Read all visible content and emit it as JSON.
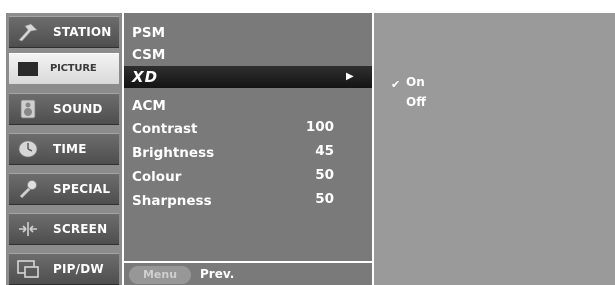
{
  "sidebar": {
    "items": [
      {
        "label": "STATION",
        "icon": "station-icon"
      },
      {
        "label": "PICTURE",
        "icon": "picture-icon",
        "selected": true
      },
      {
        "label": "SOUND",
        "icon": "sound-icon"
      },
      {
        "label": "TIME",
        "icon": "time-icon"
      },
      {
        "label": "SPECIAL",
        "icon": "special-icon"
      },
      {
        "label": "SCREEN",
        "icon": "screen-icon"
      },
      {
        "label": "PIP/DW",
        "icon": "pip-icon"
      }
    ]
  },
  "menu": {
    "items": [
      {
        "label": "PSM"
      },
      {
        "label": "CSM"
      },
      {
        "label": "XD",
        "selected": true,
        "has_submenu": true
      },
      {
        "label": "ACM"
      },
      {
        "label": "Contrast",
        "value": "100"
      },
      {
        "label": "Brightness",
        "value": "45"
      },
      {
        "label": "Colour",
        "value": "50"
      },
      {
        "label": "Sharpness",
        "value": "50"
      }
    ]
  },
  "submenu": {
    "options": [
      {
        "label": "On",
        "checked": true
      },
      {
        "label": "Off"
      }
    ]
  },
  "bottom": {
    "menu_key": "Menu",
    "prev_label": "Prev."
  },
  "colors": {
    "selected_category_bg": "#e8e8e8",
    "category_bg": "#5e5e5e",
    "menu_bg": "#7a7a7a",
    "highlight_bar": "#1f1f1f",
    "submenu_bg": "#9a9a9a"
  }
}
